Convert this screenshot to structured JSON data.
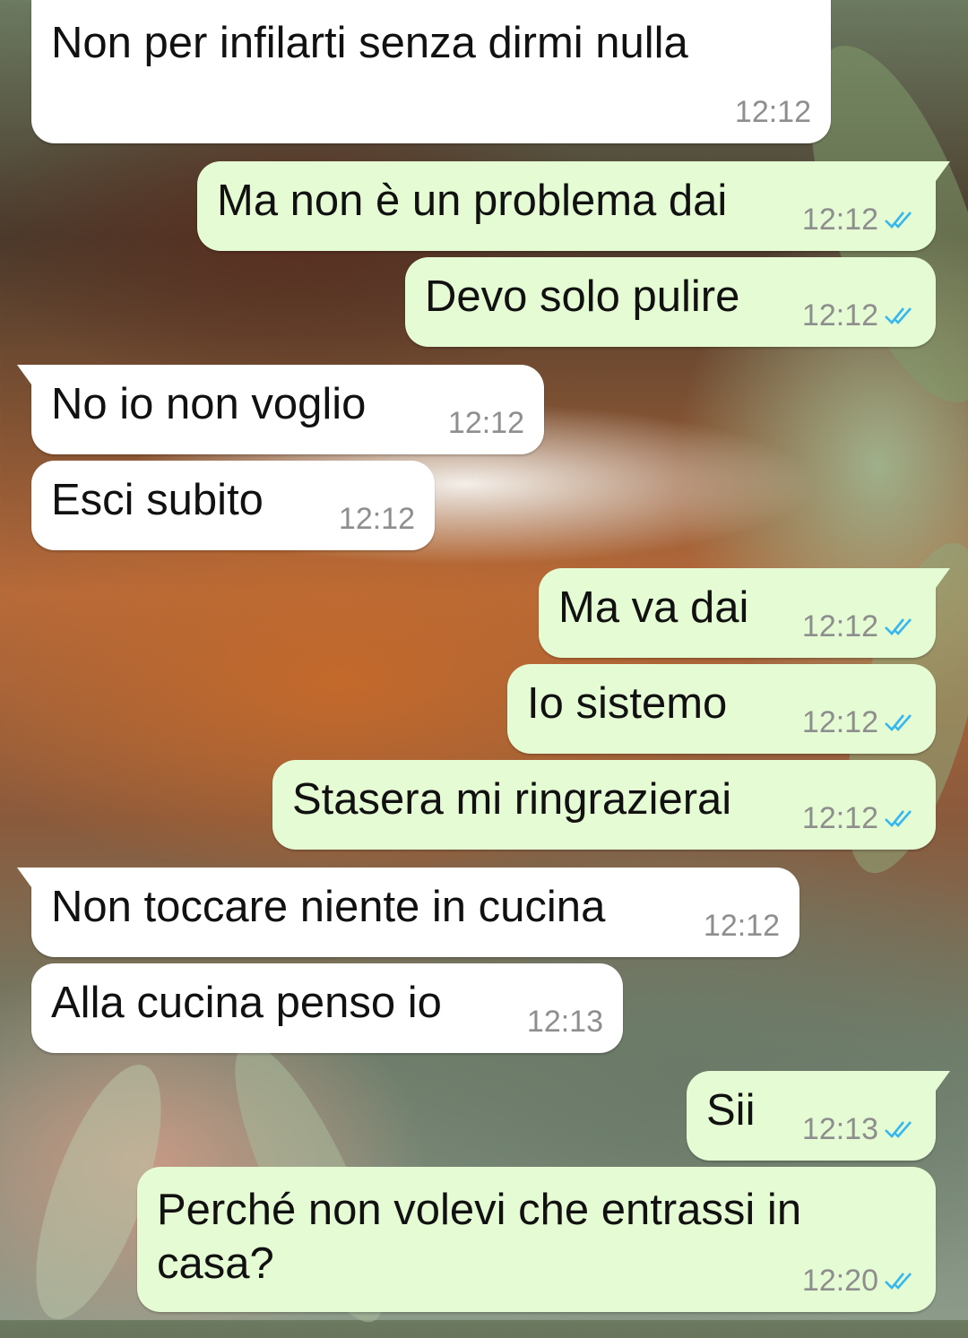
{
  "colors": {
    "incoming_bg": "#ffffff",
    "outgoing_bg": "#e5fbd3",
    "read_ticks": "#34b7f1",
    "timestamp": "#8e8e8e"
  },
  "messages": [
    {
      "direction": "in",
      "text": "Non per infilarti senza dirmi nulla",
      "time": "12:12"
    },
    {
      "direction": "out",
      "text": "Ma non è un problema dai",
      "time": "12:12",
      "status": "read"
    },
    {
      "direction": "out",
      "text": "Devo solo pulire",
      "time": "12:12",
      "status": "read"
    },
    {
      "direction": "in",
      "text": "No io non voglio",
      "time": "12:12"
    },
    {
      "direction": "in",
      "text": "Esci subito",
      "time": "12:12"
    },
    {
      "direction": "out",
      "text": "Ma va dai",
      "time": "12:12",
      "status": "read"
    },
    {
      "direction": "out",
      "text": "Io sistemo",
      "time": "12:12",
      "status": "read"
    },
    {
      "direction": "out",
      "text": "Stasera mi ringrazierai",
      "time": "12:12",
      "status": "read"
    },
    {
      "direction": "in",
      "text": "Non toccare niente in cucina",
      "time": "12:12"
    },
    {
      "direction": "in",
      "text": "Alla cucina penso io",
      "time": "12:13"
    },
    {
      "direction": "out",
      "text": "Sii",
      "time": "12:13",
      "status": "read"
    },
    {
      "direction": "out",
      "text": "Perché non volevi che entrassi in casa?",
      "time": "12:20",
      "status": "read"
    }
  ]
}
